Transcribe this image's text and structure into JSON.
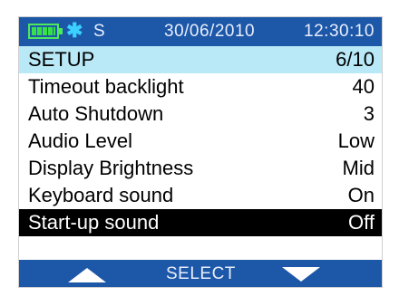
{
  "status": {
    "battery_icon": "battery-full-icon",
    "bluetooth_icon": "bluetooth-icon",
    "bluetooth_glyph": "✱",
    "satellite_text": "S",
    "date": "30/06/2010",
    "time": "12:30:10"
  },
  "menu": {
    "title": "SETUP",
    "page": "6/10",
    "items": [
      {
        "label": "Timeout backlight",
        "value": "40"
      },
      {
        "label": "Auto Shutdown",
        "value": "3"
      },
      {
        "label": "Audio Level",
        "value": "Low"
      },
      {
        "label": "Display Brightness",
        "value": "Mid"
      },
      {
        "label": "Keyboard sound",
        "value": "On"
      },
      {
        "label": "Start-up sound",
        "value": "Off"
      }
    ],
    "selected_index": 5
  },
  "softkeys": {
    "left_icon": "arrow-up-icon",
    "center_label": "SELECT",
    "right_icon": "arrow-down-icon"
  },
  "colors": {
    "bar_blue": "#1c57a8",
    "header_cyan": "#b9e8f6",
    "selected_black": "#000000",
    "battery_green": "#37e04a",
    "bluetooth_cyan": "#3ad0ff"
  }
}
